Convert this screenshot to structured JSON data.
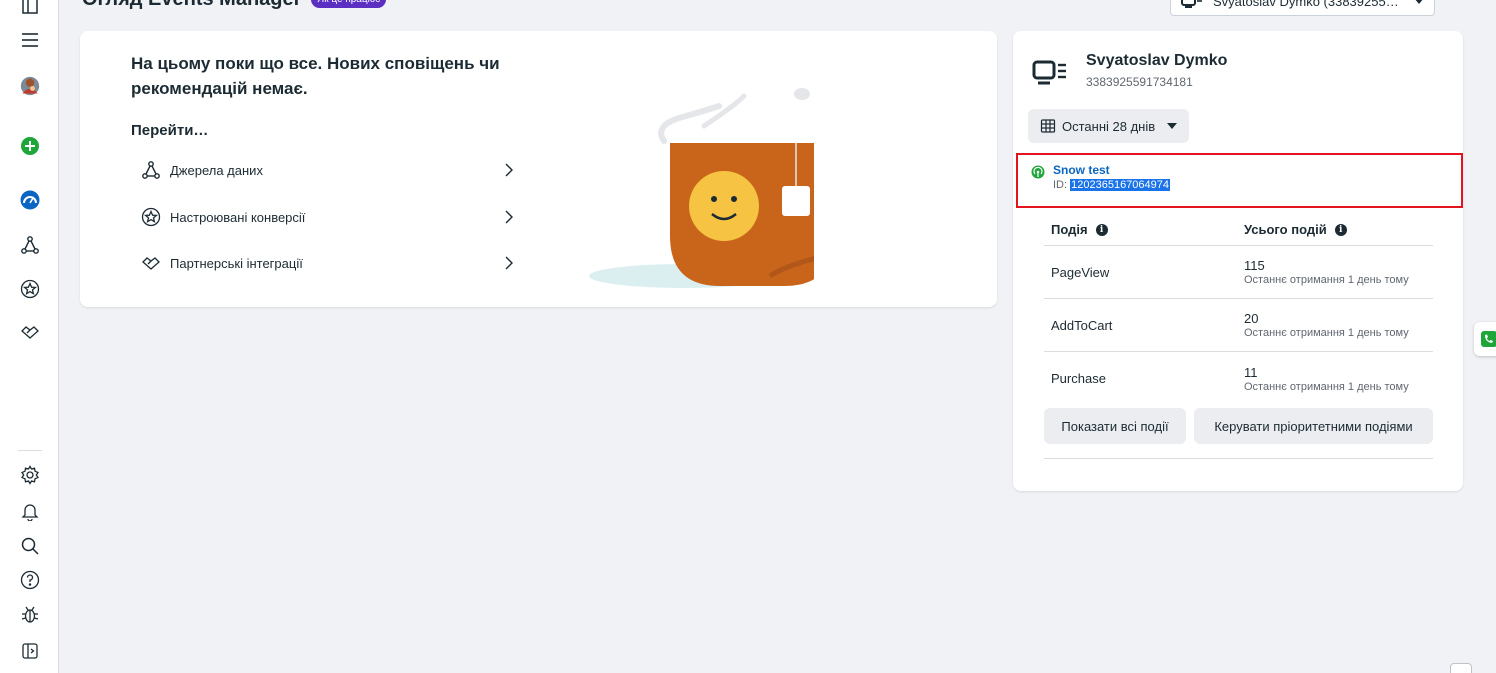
{
  "header": {
    "title": "Огляд Events Manager",
    "badge": "Як це працює",
    "account_select": "Svyatoslav Dymko (33839255917..."
  },
  "rail": {
    "icons": [
      "home-icon",
      "menu-icon",
      "avatar",
      "create-plus-icon",
      "overview-dashboard-icon",
      "data-sources-icon",
      "custom-conversions-icon",
      "partner-integrations-icon",
      "settings-icon",
      "notifications-icon",
      "search-icon",
      "help-icon",
      "debug-bug-icon",
      "sidebar-toggle-icon"
    ]
  },
  "main": {
    "empty_message": "На цьому поки що все. Нових сповіщень чи рекомендацій немає.",
    "goto_label": "Перейти…",
    "links": [
      {
        "label": "Джерела даних",
        "icon": "data-sources-icon"
      },
      {
        "label": "Настроювані конверсії",
        "icon": "custom-conversions-icon"
      },
      {
        "label": "Партнерські інтеграції",
        "icon": "partner-integrations-icon"
      }
    ]
  },
  "side": {
    "pixel_name": "Svyatoslav Dymko",
    "pixel_id": "3383925591734181",
    "date_range": "Останні 28 днів",
    "dataset": {
      "name": "Snow test",
      "id_prefix": "ID: ",
      "id": "1202365167064974"
    },
    "table": {
      "col_event": "Подія",
      "col_total": "Усього подій",
      "rows": [
        {
          "event": "PageView",
          "count": "115",
          "last": "Останнє отримання 1 день тому"
        },
        {
          "event": "AddToCart",
          "count": "20",
          "last": "Останнє отримання 1 день тому"
        },
        {
          "event": "Purchase",
          "count": "11",
          "last": "Останнє отримання 1 день тому"
        }
      ]
    },
    "show_all_button": "Показати всі події",
    "manage_priority_button": "Керувати пріоритетними подіями"
  },
  "colors": {
    "accent": "#5a2fc2",
    "link": "#0a66c2",
    "highlight_border": "#e3141e",
    "mug": "#c9651a"
  }
}
